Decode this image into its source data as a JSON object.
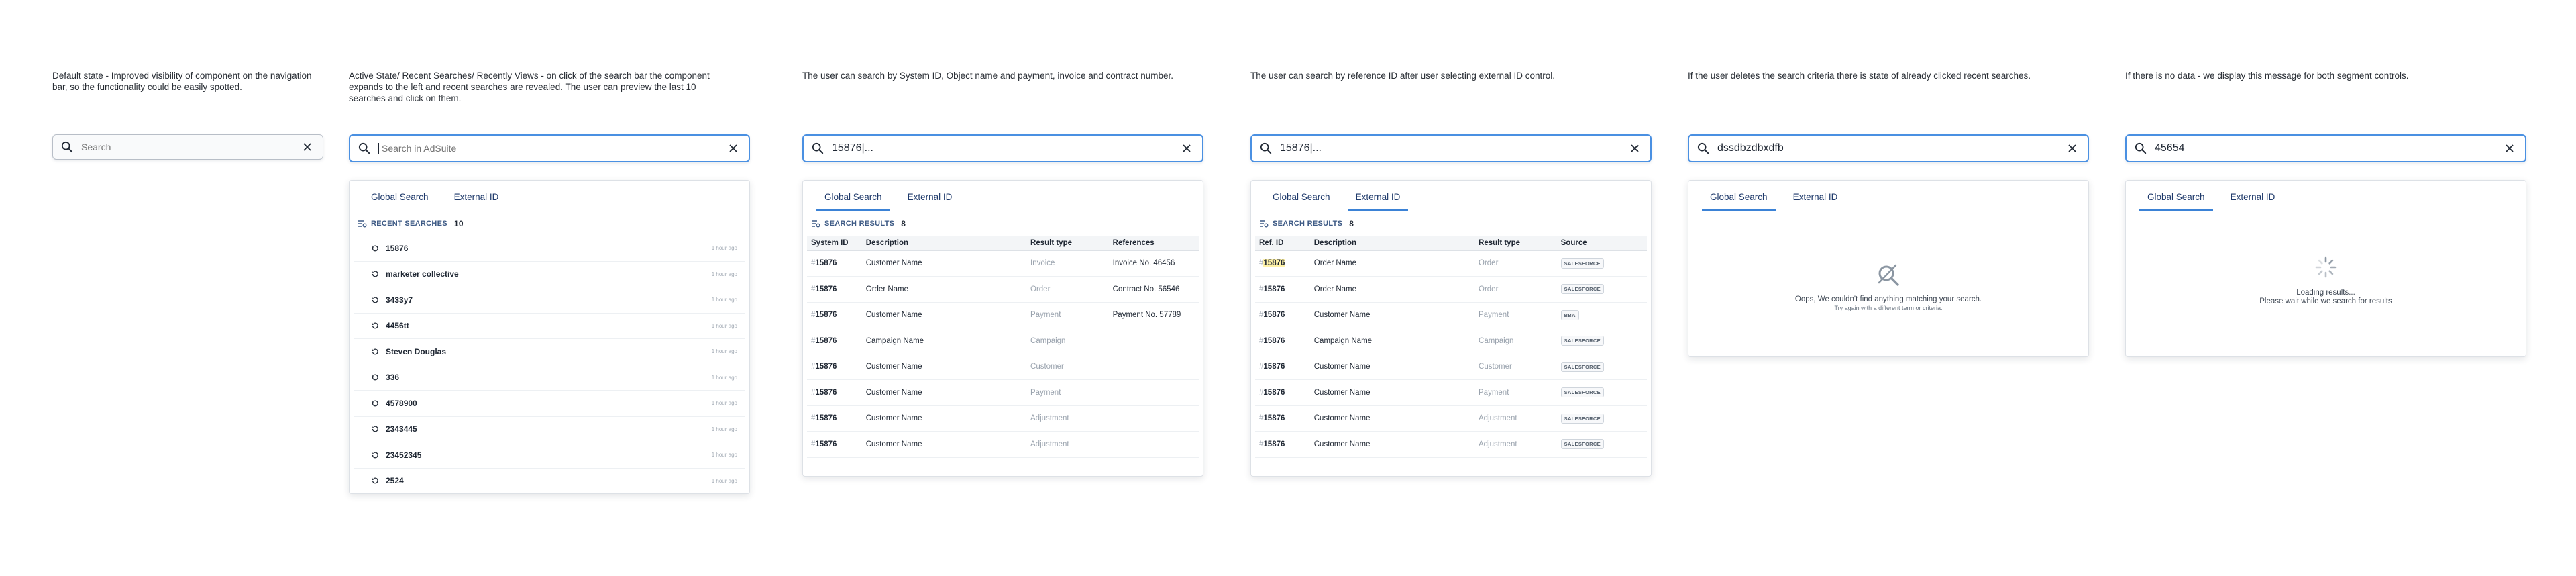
{
  "columns": [
    {
      "description": "Default state - Improved visibility of component on the navigation bar, so the functionality could be easily spotted.",
      "search": {
        "value": "",
        "placeholder": "Search"
      }
    },
    {
      "description": "Active State/ Recent Searches/ Recently Views - on click of the search bar the component expands to the left and recent searches are revealed. The user can preview the last 10 searches and click on them.",
      "search": {
        "value": "",
        "placeholder": "Search in AdSuite"
      },
      "tabs": [
        "Global Search",
        "External ID"
      ],
      "section_label": "RECENT SEARCHES",
      "section_count": "10",
      "recent_items": [
        {
          "text": "15876",
          "time": "1 hour ago"
        },
        {
          "text": "marketer collective",
          "time": "1 hour ago"
        },
        {
          "text": "3433y7",
          "time": "1 hour ago"
        },
        {
          "text": "4456tt",
          "time": "1 hour ago"
        },
        {
          "text": "Steven Douglas",
          "time": "1 hour ago"
        },
        {
          "text": "336",
          "time": "1 hour ago"
        },
        {
          "text": "4578900",
          "time": "1 hour ago"
        },
        {
          "text": "2343445",
          "time": "1 hour ago"
        },
        {
          "text": "23452345",
          "time": "1 hour ago"
        },
        {
          "text": "2524",
          "time": "1 hour ago"
        }
      ]
    },
    {
      "description": "The user can search by System ID, Object name and payment, invoice and contract number.",
      "search": {
        "value": "15876|...",
        "placeholder": ""
      },
      "tabs": [
        "Global Search",
        "External ID"
      ],
      "section_label": "SEARCH RESULTS",
      "section_count": "8",
      "table_headers": [
        "System ID",
        "Description",
        "Result type",
        "References"
      ],
      "rows": [
        {
          "id": "15876",
          "desc": "Customer Name",
          "type": "Invoice",
          "ref": "Invoice No. 46456"
        },
        {
          "id": "15876",
          "desc": "Order Name",
          "type": "Order",
          "ref": "Contract No. 56546"
        },
        {
          "id": "15876",
          "desc": "Customer Name",
          "type": "Payment",
          "ref": "Payment No. 57789"
        },
        {
          "id": "15876",
          "desc": "Campaign Name",
          "type": "Campaign",
          "ref": ""
        },
        {
          "id": "15876",
          "desc": "Customer Name",
          "type": "Customer",
          "ref": ""
        },
        {
          "id": "15876",
          "desc": "Customer Name",
          "type": "Payment",
          "ref": ""
        },
        {
          "id": "15876",
          "desc": "Customer Name",
          "type": "Adjustment",
          "ref": ""
        },
        {
          "id": "15876",
          "desc": "Customer Name",
          "type": "Adjustment",
          "ref": ""
        }
      ]
    },
    {
      "description": "The user can search by reference ID after user selecting external ID control.",
      "search": {
        "value": "15876|...",
        "placeholder": ""
      },
      "tabs": [
        "Global Search",
        "External ID"
      ],
      "section_label": "SEARCH RESULTS",
      "section_count": "8",
      "table_headers": [
        "Ref. ID",
        "Description",
        "Result type",
        "Source"
      ],
      "rows": [
        {
          "id": "15876",
          "desc": "Order Name",
          "type": "Order",
          "src": "SALESFORCE"
        },
        {
          "id": "15876",
          "desc": "Order Name",
          "type": "Order",
          "src": "SALESFORCE"
        },
        {
          "id": "15876",
          "desc": "Customer Name",
          "type": "Payment",
          "src": "BBA"
        },
        {
          "id": "15876",
          "desc": "Campaign Name",
          "type": "Campaign",
          "src": "SALESFORCE"
        },
        {
          "id": "15876",
          "desc": "Customer Name",
          "type": "Customer",
          "src": "SALESFORCE"
        },
        {
          "id": "15876",
          "desc": "Customer Name",
          "type": "Payment",
          "src": "SALESFORCE"
        },
        {
          "id": "15876",
          "desc": "Customer Name",
          "type": "Adjustment",
          "src": "SALESFORCE"
        },
        {
          "id": "15876",
          "desc": "Customer Name",
          "type": "Adjustment",
          "src": "SALESFORCE"
        }
      ]
    },
    {
      "description": "If the user deletes the search criteria there is state of already clicked recent searches.",
      "search": {
        "value": "dssdbzdbxdfb",
        "placeholder": ""
      },
      "tabs": [
        "Global Search",
        "External ID"
      ],
      "empty_title": "Oops, We couldn't find anything matching your search.",
      "empty_sub": "Try again with a different term or criteria."
    },
    {
      "description": "If there is no data - we display this message for both segment controls.",
      "search": {
        "value": "45654",
        "placeholder": ""
      },
      "tabs": [
        "Global Search",
        "External ID"
      ],
      "loading_title": "Loading results...",
      "loading_sub": "Please wait while we search for results"
    }
  ],
  "colors": {
    "accent": "#3b82d6",
    "focus_border": "#4a90e2",
    "highlight": "#fff2a8"
  }
}
